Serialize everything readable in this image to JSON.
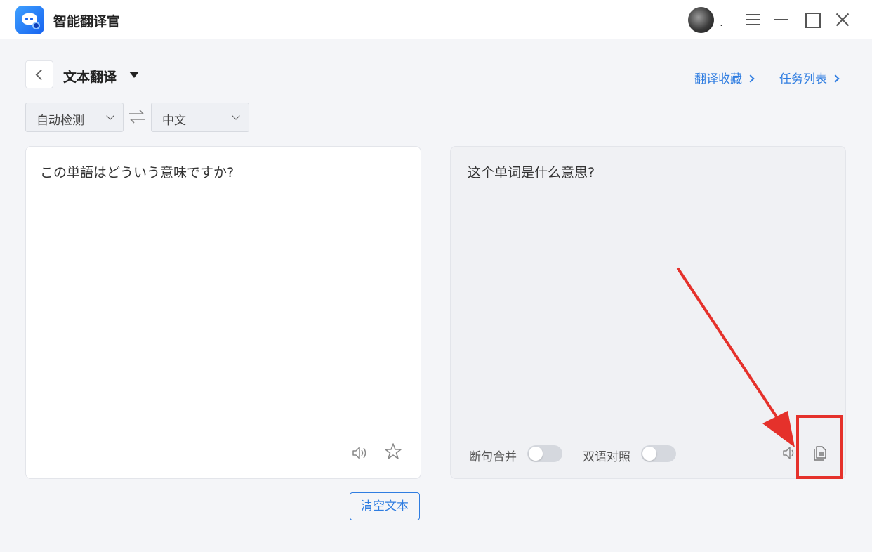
{
  "app": {
    "title": "智能翻译官",
    "avatar_suffix": "."
  },
  "header": {
    "page_title": "文本翻译",
    "favorites_link": "翻译收藏",
    "tasks_link": "任务列表"
  },
  "languages": {
    "source": "自动检测",
    "target": "中文"
  },
  "source_panel": {
    "text": "この単語はどういう意味ですか?"
  },
  "target_panel": {
    "text": "这个单词是什么意思?",
    "merge_label": "断句合并",
    "merge_on": false,
    "bilingual_label": "双语对照",
    "bilingual_on": false
  },
  "actions": {
    "clear_label": "清空文本"
  },
  "colors": {
    "accent": "#2f7de1",
    "annotation": "#e5312b"
  }
}
